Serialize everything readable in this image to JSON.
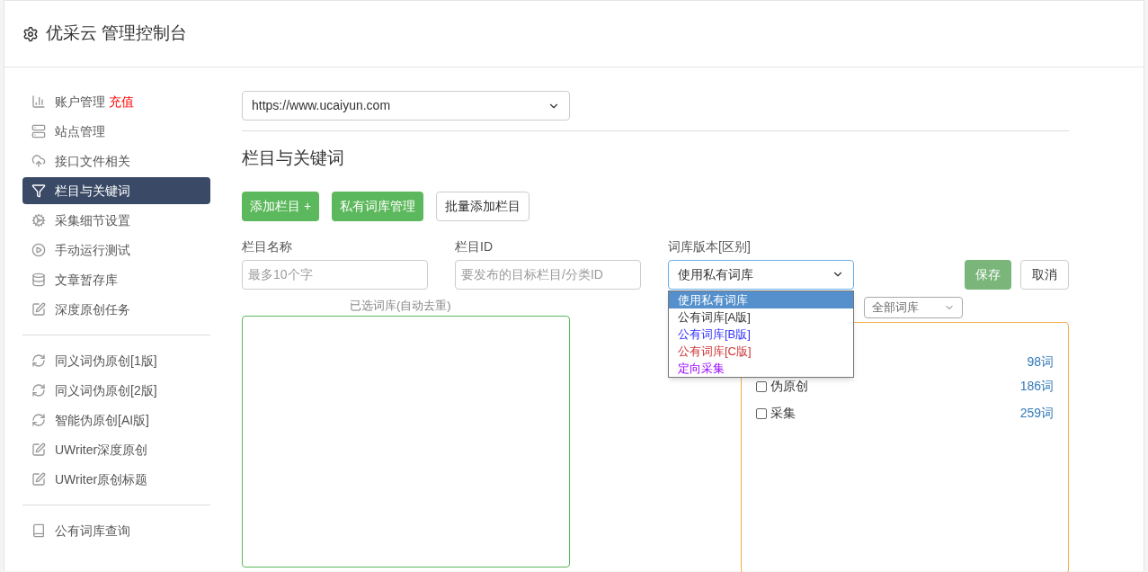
{
  "header": {
    "title": "优采云 管理控制台"
  },
  "sidebar": {
    "groups": [
      [
        {
          "label": "账户管理",
          "badge": "充值",
          "selected": false
        },
        {
          "label": "站点管理",
          "selected": false
        },
        {
          "label": "接口文件相关",
          "selected": false
        },
        {
          "label": "栏目与关键词",
          "selected": true
        },
        {
          "label": "采集细节设置",
          "selected": false
        },
        {
          "label": "手动运行测试",
          "selected": false
        },
        {
          "label": "文章暂存库",
          "selected": false
        },
        {
          "label": "深度原创任务",
          "selected": false
        }
      ],
      [
        {
          "label": "同义词伪原创[1版]",
          "selected": false
        },
        {
          "label": "同义词伪原创[2版]",
          "selected": false
        },
        {
          "label": "智能伪原创[AI版]",
          "selected": false
        },
        {
          "label": "UWriter深度原创",
          "selected": false
        },
        {
          "label": "UWriter原创标题",
          "selected": false
        }
      ],
      [
        {
          "label": "公有词库查询",
          "selected": false
        }
      ]
    ]
  },
  "site_select": {
    "value": "https://www.ucaiyun.com"
  },
  "section_title": "栏目与关键词",
  "toolbar": [
    {
      "label": "添加栏目 +",
      "kind": "primary"
    },
    {
      "label": "私有词库管理",
      "kind": "primary"
    },
    {
      "label": "批量添加栏目",
      "kind": "default"
    }
  ],
  "form": {
    "name": {
      "label": "栏目名称",
      "placeholder": "最多10个字"
    },
    "id": {
      "label": "栏目ID",
      "placeholder": "要发布的目标栏目/分类ID"
    },
    "version": {
      "label": "词库版本[区别]",
      "value": "使用私有词库",
      "expanded": true,
      "options": [
        {
          "label": "使用私有词库",
          "selected": true
        },
        {
          "label": "公有词库[A版]",
          "selected": false,
          "color": "#333333"
        },
        {
          "label": "公有词库[B版]",
          "selected": false,
          "color": "#3333ff"
        },
        {
          "label": "公有词库[C版]",
          "selected": false,
          "color": "#cc3333"
        },
        {
          "label": "定向采集",
          "selected": false,
          "color": "#9900ff"
        }
      ]
    },
    "save": "保存",
    "cancel": "取消"
  },
  "selected_library": {
    "label": "已选词库(自动去重)"
  },
  "library_filter": {
    "value": "全部词库"
  },
  "libraries": [
    {
      "count": "98词"
    },
    {
      "label": "伪原创",
      "count": "186词",
      "checked": false
    },
    {
      "label": "采集",
      "count": "259词",
      "checked": false
    }
  ]
}
